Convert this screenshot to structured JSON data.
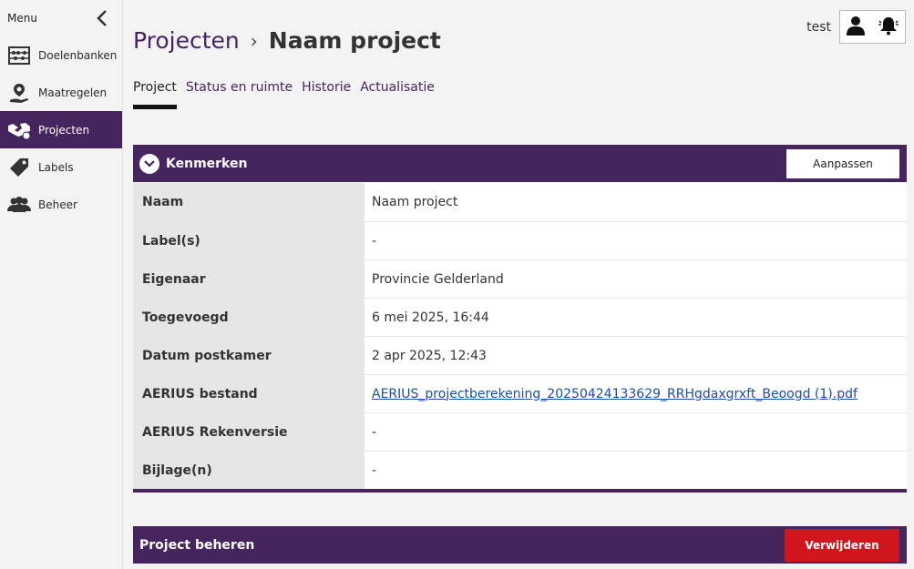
{
  "sidebar": {
    "menu_label": "Menu",
    "items": [
      {
        "label": "Doelenbanken",
        "icon": "abacus-icon"
      },
      {
        "label": "Maatregelen",
        "icon": "location-hand-icon"
      },
      {
        "label": "Projecten",
        "icon": "handshake-icon",
        "active": true
      },
      {
        "label": "Labels",
        "icon": "tag-icon"
      },
      {
        "label": "Beheer",
        "icon": "users-icon"
      }
    ]
  },
  "header": {
    "breadcrumb_root": "Projecten",
    "breadcrumb_sep": "›",
    "breadcrumb_current": "Naam project",
    "user_name": "test"
  },
  "tabs": [
    {
      "label": "Project",
      "active": true
    },
    {
      "label": "Status en ruimte"
    },
    {
      "label": "Historie"
    },
    {
      "label": "Actualisatie"
    }
  ],
  "kenmerken": {
    "title": "Kenmerken",
    "edit_label": "Aanpassen",
    "rows": [
      {
        "key": "Naam",
        "value": "Naam project"
      },
      {
        "key": "Label(s)",
        "value": "-"
      },
      {
        "key": "Eigenaar",
        "value": "Provincie Gelderland"
      },
      {
        "key": "Toegevoegd",
        "value": "6 mei 2025, 16:44"
      },
      {
        "key": "Datum postkamer",
        "value": "2 apr 2025, 12:43"
      },
      {
        "key": "AERIUS bestand",
        "value": "AERIUS_projectberekening_20250424133629_RRHgdaxgrxft_Beoogd (1).pdf",
        "link": true
      },
      {
        "key": "AERIUS Rekenversie",
        "value": "-"
      },
      {
        "key": "Bijlage(n)",
        "value": "-"
      }
    ]
  },
  "beheren": {
    "title": "Project beheren",
    "delete_label": "Verwijderen"
  },
  "colors": {
    "brand": "#46245e",
    "danger": "#d0161d",
    "link": "#1a4ea8"
  }
}
